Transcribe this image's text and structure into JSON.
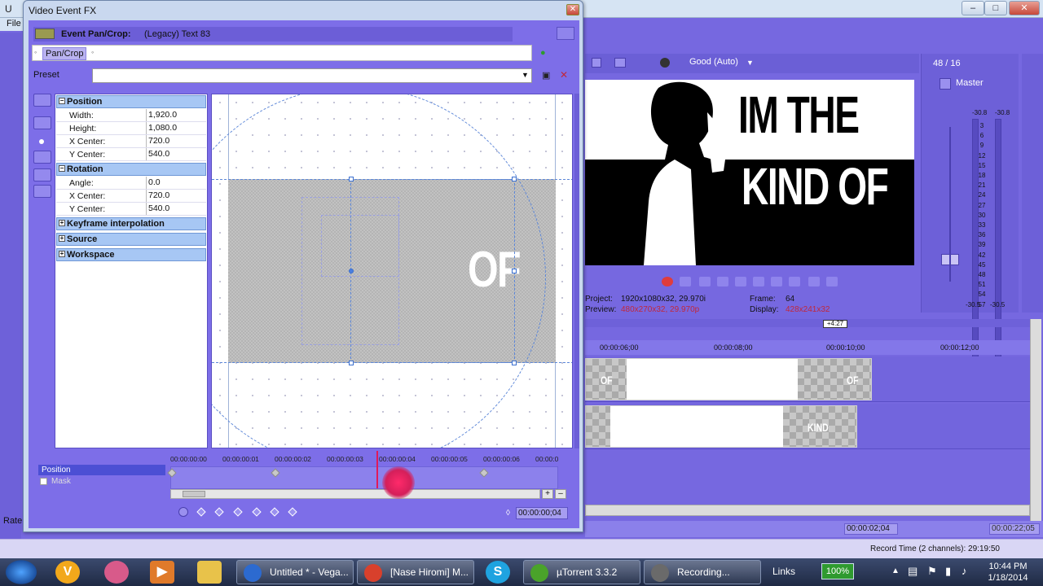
{
  "main_window": {
    "title": "U",
    "menu_first": "File",
    "rate_label": "Rate",
    "preview": {
      "frame_counter": "48 / 16",
      "quality": "Good (Auto)",
      "overlay_line1": "IM THE",
      "overlay_line2": "KIND OF",
      "project_label": "Project:",
      "project_value": "1920x1080x32, 29.970i",
      "preview_label": "Preview:",
      "preview_value": "480x270x32, 29.970p",
      "frame_label": "Frame:",
      "frame_value": "64",
      "display_label": "Display:",
      "display_value": "428x241x32"
    },
    "master": {
      "label": "Master",
      "peak_left": "-30.8",
      "peak_right": "-30.8",
      "scale": [
        "3",
        "6",
        "9",
        "12",
        "15",
        "18",
        "21",
        "24",
        "27",
        "30",
        "33",
        "36",
        "39",
        "42",
        "45",
        "48",
        "51",
        "54",
        "57"
      ],
      "bottom_left": "-30.5",
      "bottom_right": "-30.5"
    },
    "timeline": {
      "marker": "+4:27",
      "ruler": [
        "00:00:06;00",
        "00:00:08;00",
        "00:00:10;00",
        "00:00:12;00"
      ],
      "track1_clip_text": "OF",
      "track1_clip_text2": "OF",
      "track2_clip_text": "KIND",
      "cursor_time": "00:00:02;04",
      "end_time": "00:00:22;05"
    },
    "record_time": "Record Time (2 channels): 29:19:50"
  },
  "dialog": {
    "title": "Video Event FX",
    "fx_name": "Event Pan/Crop:",
    "fx_desc": "(Legacy) Text 83",
    "chain_button": "Pan/Crop",
    "preset_label": "Preset",
    "preset_value": "",
    "sections": {
      "position": {
        "label": "Position",
        "rows": [
          {
            "label": "Width:",
            "value": "1,920.0"
          },
          {
            "label": "Height:",
            "value": "1,080.0"
          },
          {
            "label": "X Center:",
            "value": "720.0"
          },
          {
            "label": "Y Center:",
            "value": "540.0"
          }
        ]
      },
      "rotation": {
        "label": "Rotation",
        "rows": [
          {
            "label": "Angle:",
            "value": "0.0"
          },
          {
            "label": "X Center:",
            "value": "720.0"
          },
          {
            "label": "Y Center:",
            "value": "540.0"
          }
        ]
      },
      "keyframe_interpolation": "Keyframe interpolation",
      "source": "Source",
      "workspace": "Workspace"
    },
    "canvas_text": "OF",
    "keyframes": {
      "ruler": [
        "00:00:00:00",
        "00:00:00:01",
        "00:00:00:02",
        "00:00:00:03",
        "00:00:00:04",
        "00:00:00:05",
        "00:00:00:06",
        "00:00:0"
      ],
      "track_position": "Position",
      "track_mask": "Mask",
      "time_readout": "00:00:00;04"
    }
  },
  "taskbar": {
    "tasks": [
      {
        "label": "Untitled * - Vega...",
        "color": "#2c6ad0"
      },
      {
        "label": "[Nase Hiromi] M...",
        "color": "#d8402c"
      },
      {
        "label": "µTorrent 3.3.2",
        "color": "#4aa32a"
      },
      {
        "label": "Recording...",
        "color": "#6a6a6a"
      }
    ],
    "links": "Links",
    "battery": "100%",
    "time": "10:44 PM",
    "date": "1/18/2014"
  }
}
